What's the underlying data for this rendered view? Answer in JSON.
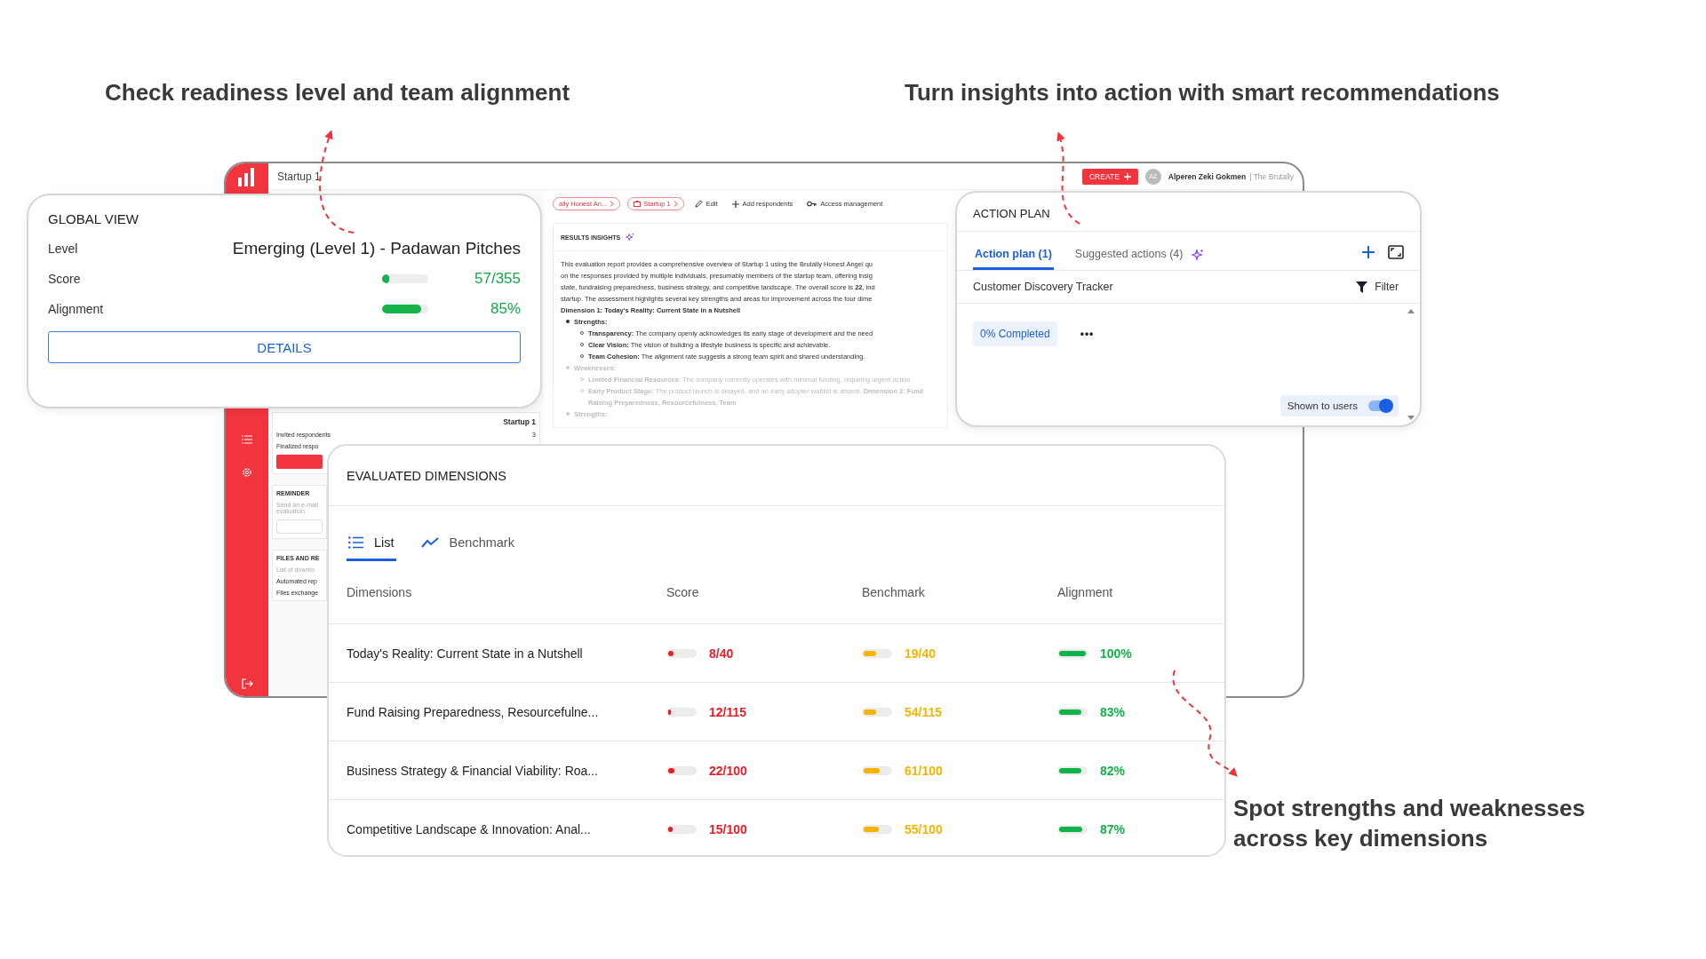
{
  "captions": [
    "Check readiness level and team alignment",
    "Turn insights into action with smart recommendations",
    "Spot strengths and weaknesses across key dimensions"
  ],
  "app_window": {
    "title": "Startup 1",
    "create_button": "CREATE",
    "user": {
      "initials": "AZ",
      "name": "Alperen Zeki Gokmen",
      "org": "| The Brutally"
    },
    "breadcrumbs": [
      "ally Honest An...",
      "Startup 1"
    ],
    "toolbar": [
      {
        "kind": "edit",
        "label": "Edit"
      },
      {
        "kind": "add",
        "label": "Add respondents"
      },
      {
        "kind": "access",
        "label": "Access management"
      }
    ],
    "side_panel": {
      "title": "Startup 1",
      "stats": [
        {
          "label": "Invited respondents",
          "value": "3"
        },
        {
          "label": "Finalized respo"
        }
      ],
      "reminder_title": "REMINDER",
      "reminder_lines": [
        "Send an e-mail",
        "evaluation."
      ],
      "files_title": "FILES AND RE",
      "files_text": "List of downlo",
      "files": [
        "Automated rep",
        "Files exchange"
      ]
    },
    "results_insights": {
      "title": "RESULTS INSIGHTS",
      "intro": [
        "This evaluation report provides a comprehensive overview of Startup 1 using the Brutally Honest Angel qu",
        "on the responses provided by multiple individuals, presumably members of the startup team, offering insig",
        "state, fundraising preparedness, business strategy, and competitive landscape. The overall score is **22**, ind",
        "startup. The assessment highlights several key strengths and areas for improvement across the four dime"
      ],
      "heading": "Dimension 1: Today's Reality: Current State in a Nutshell",
      "sections": [
        {
          "title": "Strengths:",
          "faded": false,
          "items": [
            "**Transparency:** The company openly acknowledges its early stage of development and the need",
            "**Clear Vision:** The vision of building a lifestyle business is specific and achievable.",
            "**Team Cohesion:** The alignment rate suggests a strong team spirit and shared understanding."
          ]
        },
        {
          "title": "Weaknesses:",
          "faded": true,
          "items": [
            "**Limited Financial Resources:** The company currently operates with minimal funding, requiring urgent action.",
            "**Early Product Stage:** The product launch is delayed, and an early adopter waitlist is absent. **Dimension 2: Fund Raising Preparedness, Resourcefulness, Team**"
          ]
        },
        {
          "title": "Strengths:",
          "faded": true
        }
      ]
    }
  },
  "global_view": {
    "title": "GLOBAL VIEW",
    "rows": [
      {
        "kind": "text",
        "label": "Level",
        "value": "Emerging (Level 1) - Padawan Pitches"
      },
      {
        "kind": "bar",
        "label": "Score",
        "level": 0.16,
        "reading": "57/355"
      },
      {
        "kind": "bar",
        "label": "Alignment",
        "level": 0.85,
        "reading": "85%"
      }
    ],
    "button": "DETAILS"
  },
  "action_plan": {
    "title": "ACTION PLAN",
    "tabs": [
      {
        "label": "Action plan (1)",
        "selected": true
      },
      {
        "label": "Suggested actions (4)",
        "selected": false
      }
    ],
    "tracker": "Customer Discovery Tracker",
    "filter": "Filter",
    "status": "0% Completed",
    "more": "•••",
    "shown_to_users": {
      "label": "Shown to users",
      "on": true
    }
  },
  "evaluated_dimensions": {
    "title": "EVALUATED DIMENSIONS",
    "tabs": [
      {
        "label": "List",
        "selected": true
      },
      {
        "label": "Benchmark",
        "selected": false
      }
    ],
    "columns": [
      {
        "label": "Dimensions"
      },
      {
        "label": "Score",
        "color": "#ee1c25"
      },
      {
        "label": "Benchmark",
        "color": "#f5b400"
      },
      {
        "label": "Alignment",
        "color": "#12b24a"
      }
    ],
    "rows": [
      {
        "cells": [
          {
            "kind": "text",
            "text": "Today's Reality: Current State in a Nutshell"
          },
          {
            "kind": "bar",
            "level": 0.2,
            "reading": "8/40"
          },
          {
            "kind": "bar",
            "level": 0.48,
            "reading": "19/40"
          },
          {
            "kind": "bar",
            "level": 1,
            "reading": "100%"
          }
        ]
      },
      {
        "cells": [
          {
            "kind": "text",
            "text": "Fund Raising Preparedness, Resourcefulne..."
          },
          {
            "kind": "bar",
            "level": 0.1,
            "reading": "12/115"
          },
          {
            "kind": "bar",
            "level": 0.47,
            "reading": "54/115"
          },
          {
            "kind": "bar",
            "level": 0.83,
            "reading": "83%"
          }
        ]
      },
      {
        "cells": [
          {
            "kind": "text",
            "text": "Business Strategy & Financial Viability: Roa..."
          },
          {
            "kind": "bar",
            "level": 0.22,
            "reading": "22/100"
          },
          {
            "kind": "bar",
            "level": 0.61,
            "reading": "61/100"
          },
          {
            "kind": "bar",
            "level": 0.82,
            "reading": "82%"
          }
        ]
      },
      {
        "cells": [
          {
            "kind": "text",
            "text": "Competitive Landscape & Innovation: Anal..."
          },
          {
            "kind": "bar",
            "level": 0.15,
            "reading": "15/100"
          },
          {
            "kind": "bar",
            "level": 0.55,
            "reading": "55/100"
          },
          {
            "kind": "bar",
            "level": 0.87,
            "reading": "87%"
          }
        ]
      }
    ]
  }
}
